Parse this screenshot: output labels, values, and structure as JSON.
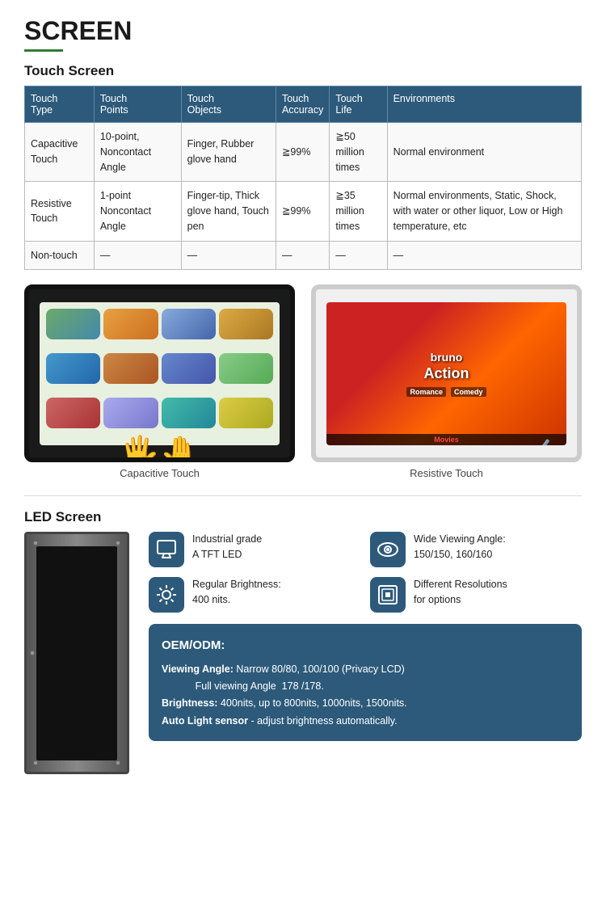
{
  "page": {
    "title": "SCREEN",
    "touch_section_title": "Touch Screen",
    "led_section_title": "LED Screen"
  },
  "table": {
    "headers": [
      "Touch Type",
      "Touch Points",
      "Touch Objects",
      "Touch Accuracy",
      "Touch Life",
      "Environments"
    ],
    "rows": [
      {
        "type": "Capacitive Touch",
        "points": "10-point, Noncontact Angle",
        "objects": "Finger, Rubber glove hand",
        "accuracy": "≧99%",
        "life": "≧50 million times",
        "environments": "Normal environment"
      },
      {
        "type": "Resistive Touch",
        "points": "1-point Noncontact Angle",
        "objects": "Finger-tip, Thick glove hand, Touch pen",
        "accuracy": "≧99%",
        "life": "≧35 million times",
        "environments": "Normal environments, Static, Shock, with water or other liquor, Low or High temperature, etc"
      },
      {
        "type": "Non-touch",
        "points": "—",
        "objects": "—",
        "accuracy": "—",
        "life": "—",
        "environments": "—"
      }
    ]
  },
  "captions": {
    "capacitive": "Capacitive Touch",
    "resistive": "Resistive Touch"
  },
  "led_features": [
    {
      "icon": "monitor",
      "text": "Industrial grade\nA TFT LED",
      "icon_char": "🖥"
    },
    {
      "icon": "eye",
      "text": "Wide Viewing Angle:\n150/150, 160/160",
      "icon_char": "👁"
    },
    {
      "icon": "brightness",
      "text": "Regular Brightness:\n400 nits.",
      "icon_char": "☀"
    },
    {
      "icon": "resolution",
      "text": "Different Resolutions\nfor options",
      "icon_char": "⊞"
    }
  ],
  "oem": {
    "title": "OEM/ODM:",
    "viewing_angle_label": "Viewing Angle:",
    "viewing_angle_value": "Narrow 80/80, 100/100 (Privacy LCD)\n              Full viewing Angle  178 /178.",
    "brightness_label": "Brightness:",
    "brightness_value": "400nits, up to 800nits, 1000nits, 1500nits.",
    "sensor_label": "Auto Light sensor",
    "sensor_value": "- adjust brightness automatically."
  }
}
